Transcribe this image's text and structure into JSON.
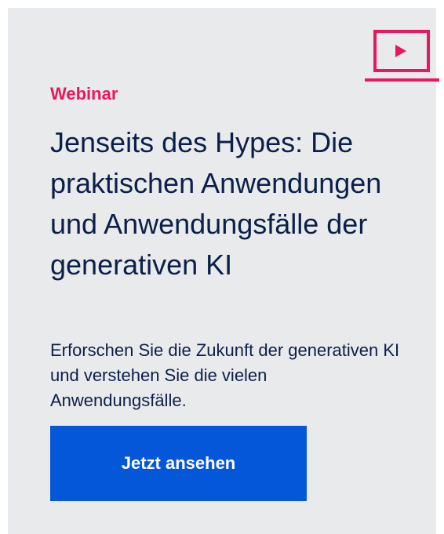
{
  "card": {
    "eyebrow": "Webinar",
    "title": "Jenseits des Hypes: Die praktischen Anwendungen und Anwendungsfälle der generativen KI",
    "description": "Erforschen Sie die Zukunft der generativen KI und verstehen Sie die vielen Anwendungsfälle.",
    "cta_label": "Jetzt ansehen",
    "icon": "video-play-icon"
  },
  "colors": {
    "background": "#e9eaeb",
    "accent": "#e8185c",
    "title_text": "#0b1f4a",
    "button_bg": "#0457d8",
    "button_text": "#ffffff"
  }
}
